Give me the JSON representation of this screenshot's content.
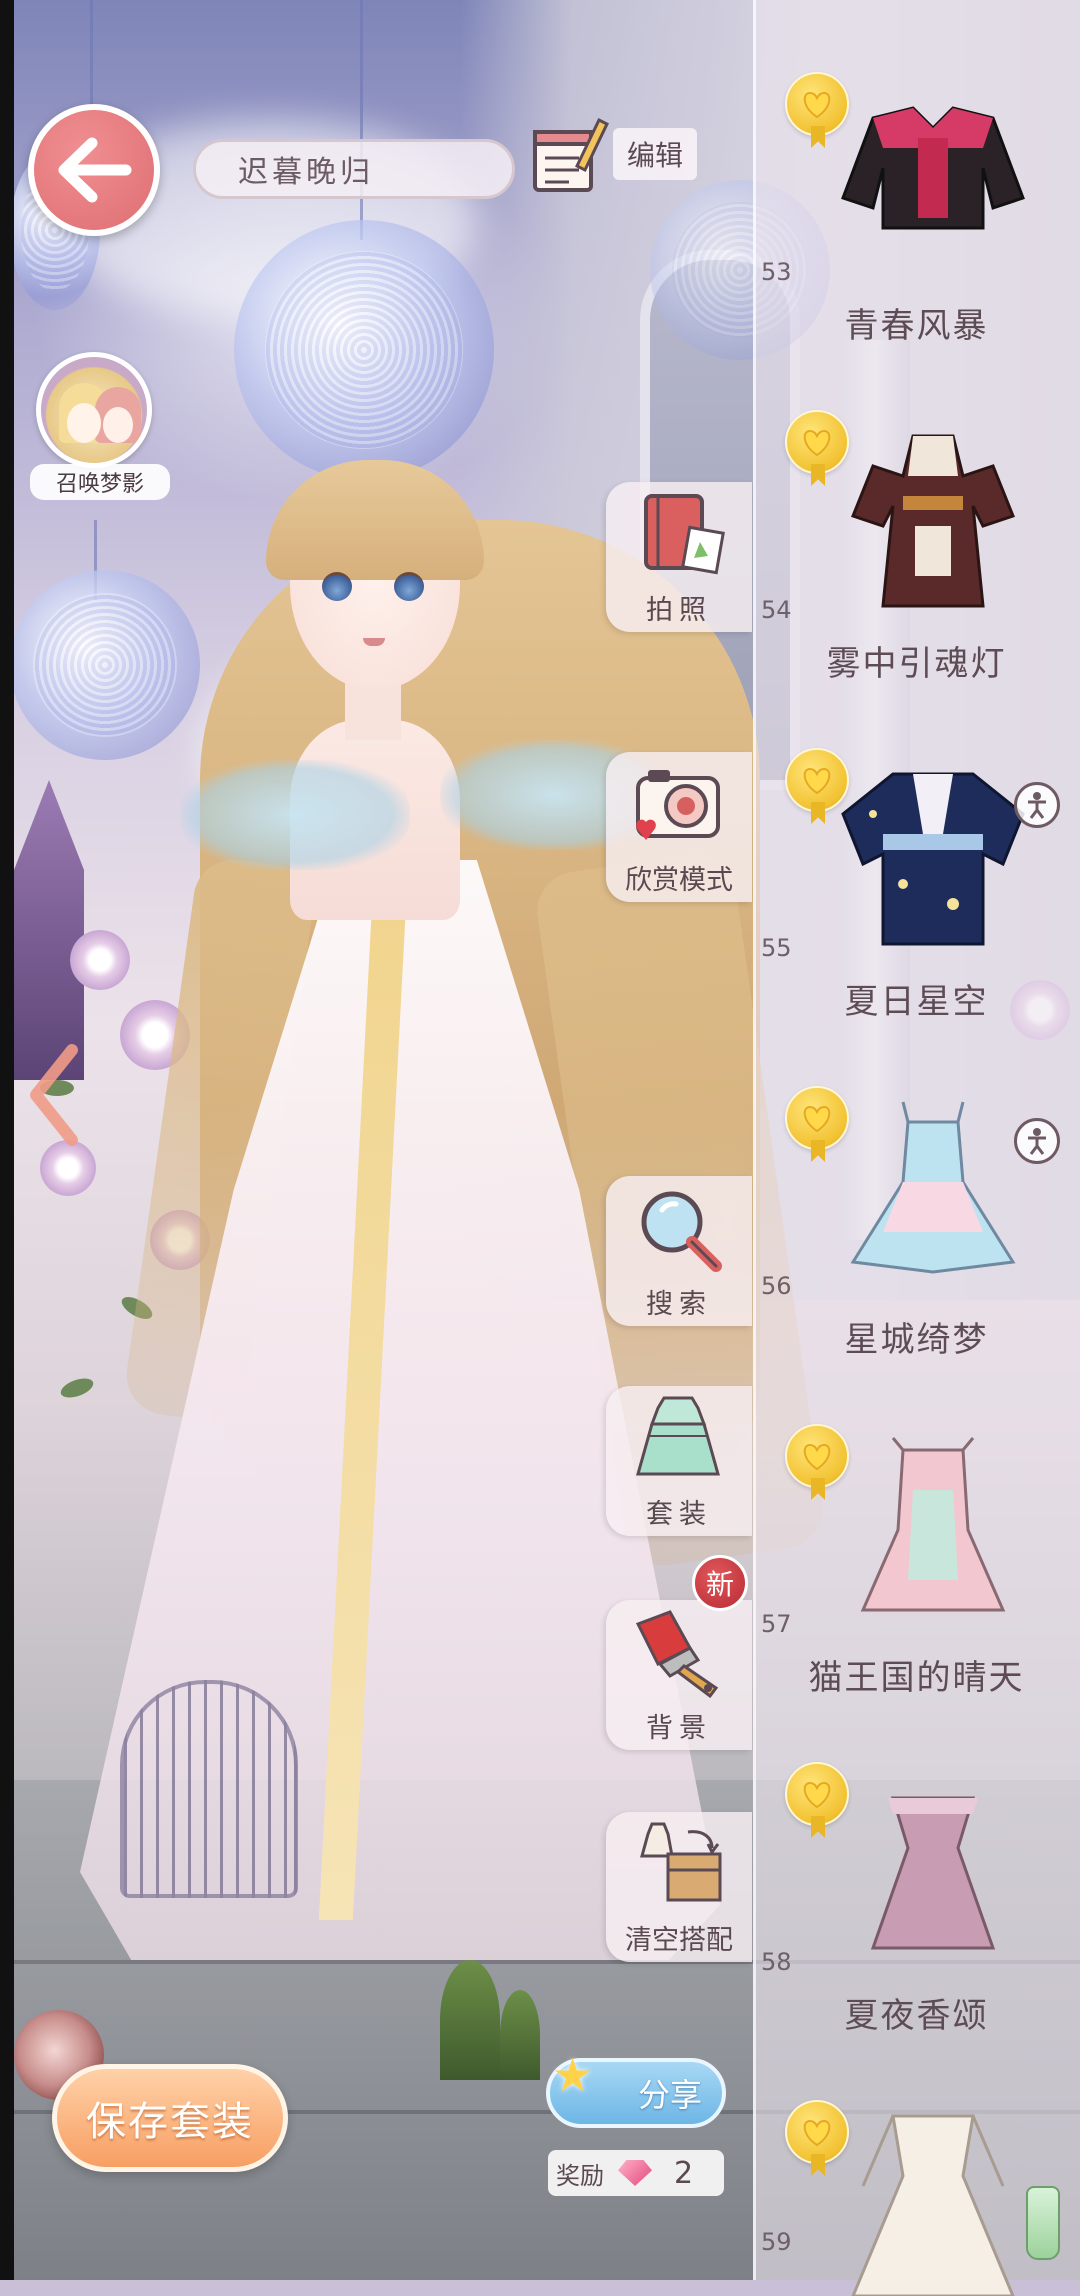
{
  "top": {
    "outfit_name": "迟暮晚归",
    "edit_label": "编辑"
  },
  "summon": {
    "label": "召唤梦影"
  },
  "tools": [
    {
      "label": "拍照",
      "icon": "photo-album-icon"
    },
    {
      "label": "欣赏模式",
      "icon": "camera-icon"
    },
    {
      "label": "搜索",
      "icon": "magnifier-icon"
    },
    {
      "label": "套装",
      "icon": "outfit-icon"
    },
    {
      "label": "背景",
      "icon": "paintbrush-icon"
    },
    {
      "label": "清空搭配",
      "icon": "clear-box-icon"
    }
  ],
  "new_badge": "新",
  "items": [
    {
      "number": "53",
      "name": "青春风暴",
      "colors": [
        "#d63a67",
        "#2a2226"
      ]
    },
    {
      "number": "54",
      "name": "雾中引魂灯",
      "colors": [
        "#5a2a2a",
        "#f0e6da"
      ]
    },
    {
      "number": "55",
      "name": "夏日星空",
      "colors": [
        "#1e2c5c",
        "#f2f0f6"
      ]
    },
    {
      "number": "56",
      "name": "星城绮梦",
      "colors": [
        "#bde2f0",
        "#f7d8e3"
      ]
    },
    {
      "number": "57",
      "name": "猫王国的晴天",
      "colors": [
        "#c9e6dd",
        "#f3c7cf"
      ]
    },
    {
      "number": "58",
      "name": "夏夜香颂",
      "colors": [
        "#c89cb2",
        "#e9cad8"
      ]
    },
    {
      "number": "59",
      "name": "",
      "colors": [
        "#f6efe6",
        "#f6efe6"
      ]
    }
  ],
  "bottom": {
    "save_label": "保存套装",
    "share_label": "分享",
    "reward_label": "奖励",
    "reward_count": "2"
  },
  "colors": {
    "accent_pink": "#de6e72",
    "save_orange": "#f79f63",
    "share_blue": "#6db6e6",
    "heart_gold": "#f2c232"
  }
}
